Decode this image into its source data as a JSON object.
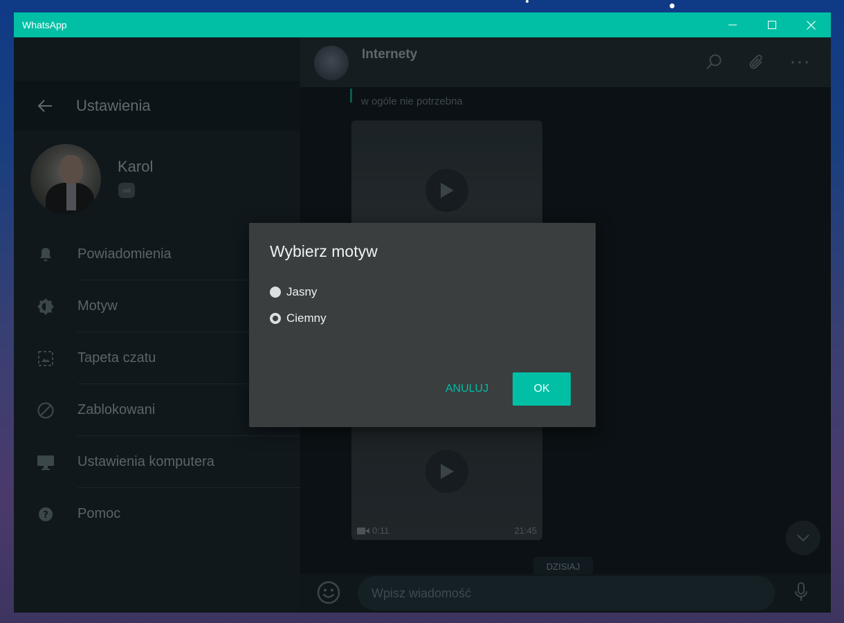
{
  "window": {
    "title": "WhatsApp"
  },
  "settings": {
    "header_title": "Ustawienia",
    "profile": {
      "name": "Karol",
      "status_badge": "okk"
    },
    "items": [
      {
        "label": "Powiadomienia",
        "icon": "bell-icon"
      },
      {
        "label": "Motyw",
        "icon": "theme-icon"
      },
      {
        "label": "Tapeta czatu",
        "icon": "wallpaper-icon"
      },
      {
        "label": "Zablokowani",
        "icon": "blocked-icon"
      },
      {
        "label": "Ustawienia komputera",
        "icon": "desktop-icon"
      },
      {
        "label": "Pomoc",
        "icon": "help-icon"
      }
    ]
  },
  "chat": {
    "name": "Internety",
    "message_snippet": "w ogóle nie potrzebna",
    "video": {
      "duration": "0:11",
      "time": "21:45"
    },
    "day_label": "DZISIAJ",
    "composer_placeholder": "Wpisz wiadomość"
  },
  "dialog": {
    "title": "Wybierz motyw",
    "options": [
      {
        "label": "Jasny",
        "selected": false
      },
      {
        "label": "Ciemny",
        "selected": true
      }
    ],
    "cancel_label": "ANULUJ",
    "ok_label": "OK"
  },
  "colors": {
    "accent": "#00bfa5",
    "dialog_bg": "#3a3e3f",
    "dark_bg": "#121b1f"
  }
}
